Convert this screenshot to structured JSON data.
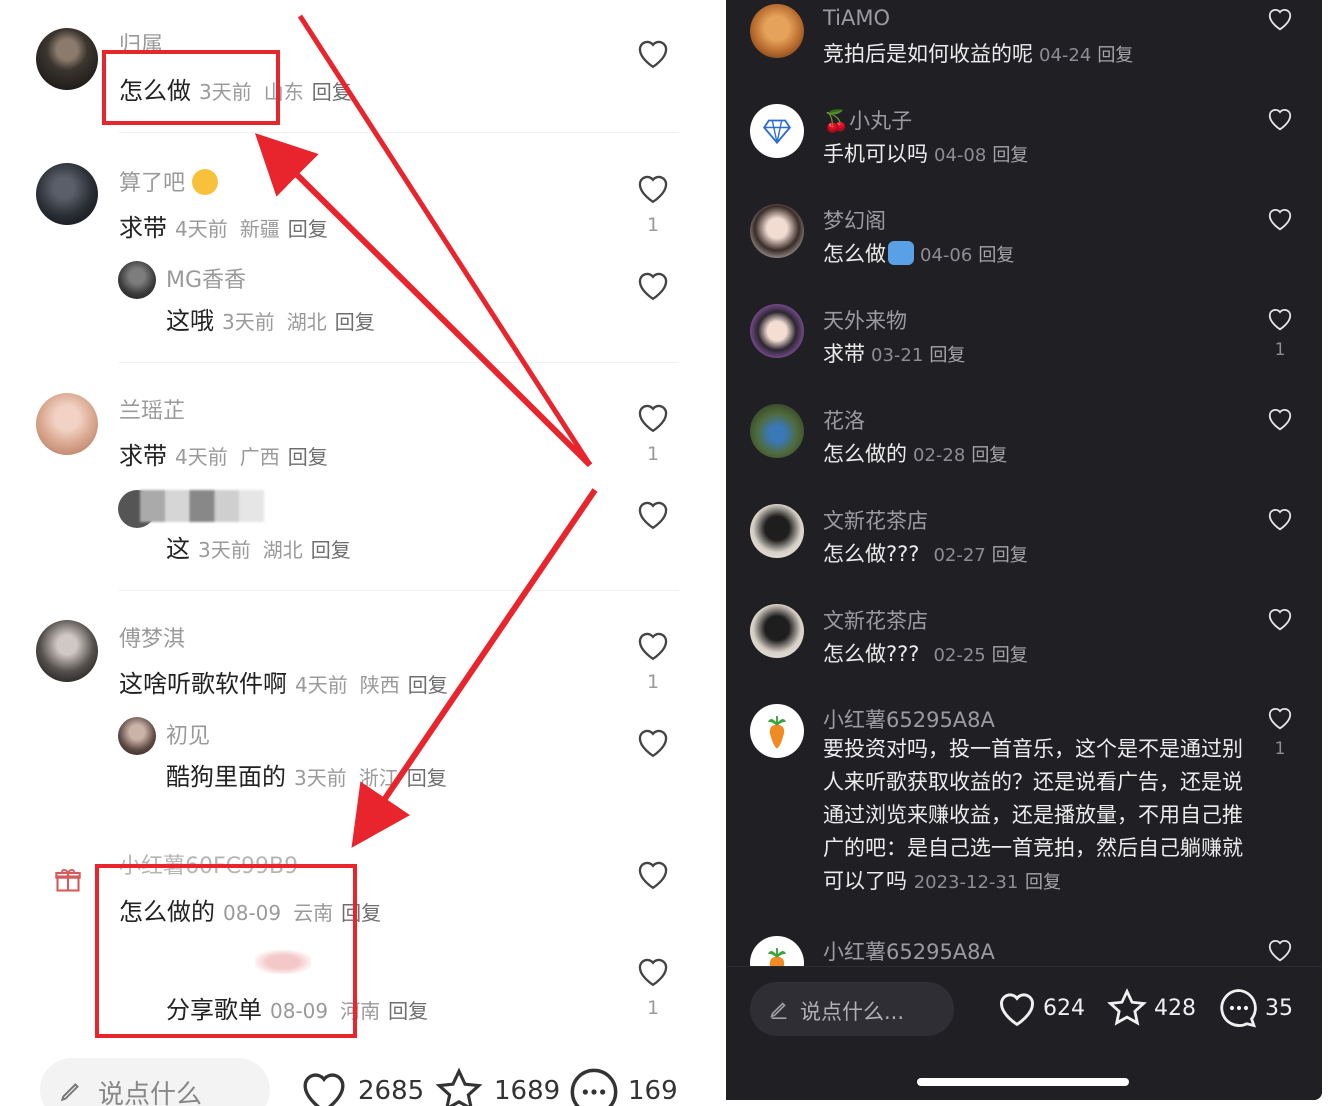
{
  "left": {
    "comments": [
      {
        "name": "归属",
        "text": "怎么做",
        "time": "3天前",
        "loc": "山东",
        "reply": "回复"
      },
      {
        "name": "算了吧",
        "text": "求带",
        "time": "4天前",
        "loc": "新疆",
        "reply": "回复",
        "likes": "1"
      },
      {
        "name": "MG香香",
        "text": "这哦",
        "time": "3天前",
        "loc": "湖北",
        "reply": "回复"
      },
      {
        "name": "兰瑶芷",
        "text": "求带",
        "time": "4天前",
        "loc": "广西",
        "reply": "回复",
        "likes": "1"
      },
      {
        "name": "",
        "text": "这",
        "time": "3天前",
        "loc": "湖北",
        "reply": "回复"
      },
      {
        "name": "傅梦淇",
        "text": "这啥听歌软件啊",
        "time": "4天前",
        "loc": "陕西",
        "reply": "回复",
        "likes": "1"
      },
      {
        "name": "初见",
        "text": "酷狗里面的",
        "time": "3天前",
        "loc": "浙江",
        "reply": "回复"
      },
      {
        "name": "小红薯60FC99B9",
        "text": "怎么做的",
        "time": "08-09",
        "loc": "云南",
        "reply": "回复"
      },
      {
        "name": "",
        "text": "分享歌单",
        "time": "08-09",
        "loc": "河南",
        "reply": "回复",
        "likes": "1"
      }
    ],
    "bottom": {
      "placeholder": "说点什么",
      "likes": "2685",
      "stars": "1689",
      "comments": "169"
    }
  },
  "right": {
    "comments": [
      {
        "name": "TiAMO",
        "text": "竞拍后是如何收益的呢",
        "time": "04-24",
        "reply": "回复"
      },
      {
        "name": "🍒小丸子",
        "text": "手机可以吗",
        "time": "04-08",
        "reply": "回复"
      },
      {
        "name": "梦幻阁",
        "text": "怎么做",
        "time": "04-06",
        "reply": "回复"
      },
      {
        "name": "天外来物",
        "text": "求带",
        "time": "03-21",
        "reply": "回复",
        "likes": "1"
      },
      {
        "name": "花洛",
        "text": "怎么做的",
        "time": "02-28",
        "reply": "回复"
      },
      {
        "name": "文新花茶店",
        "text": "怎么做???",
        "time": "02-27",
        "reply": "回复"
      },
      {
        "name": "文新花茶店",
        "text": "怎么做???",
        "time": "02-25",
        "reply": "回复"
      },
      {
        "name": "小红薯65295A8A",
        "text": "要投资对吗，投一首音乐，这个是不是通过别人来听歌获取收益的？还是说看广告，还是说通过浏览来赚收益，还是播放量，不用自己推广的吧：是自己选一首竞拍，然后自己躺赚就可以了吗",
        "time": "2023-12-31",
        "reply": "回复",
        "likes": "1"
      },
      {
        "name": "小红薯65295A8A"
      }
    ],
    "bottom": {
      "placeholder": "说点什么...",
      "likes": "624",
      "stars": "428",
      "comments": "35"
    }
  },
  "colors": {
    "highlight": "#e8242c",
    "dark_bg": "#1f1f24"
  },
  "icons": [
    "heart-icon",
    "star-icon",
    "chat-icon",
    "pencil-icon",
    "gift-icon",
    "diamond-icon",
    "carrot-icon"
  ]
}
